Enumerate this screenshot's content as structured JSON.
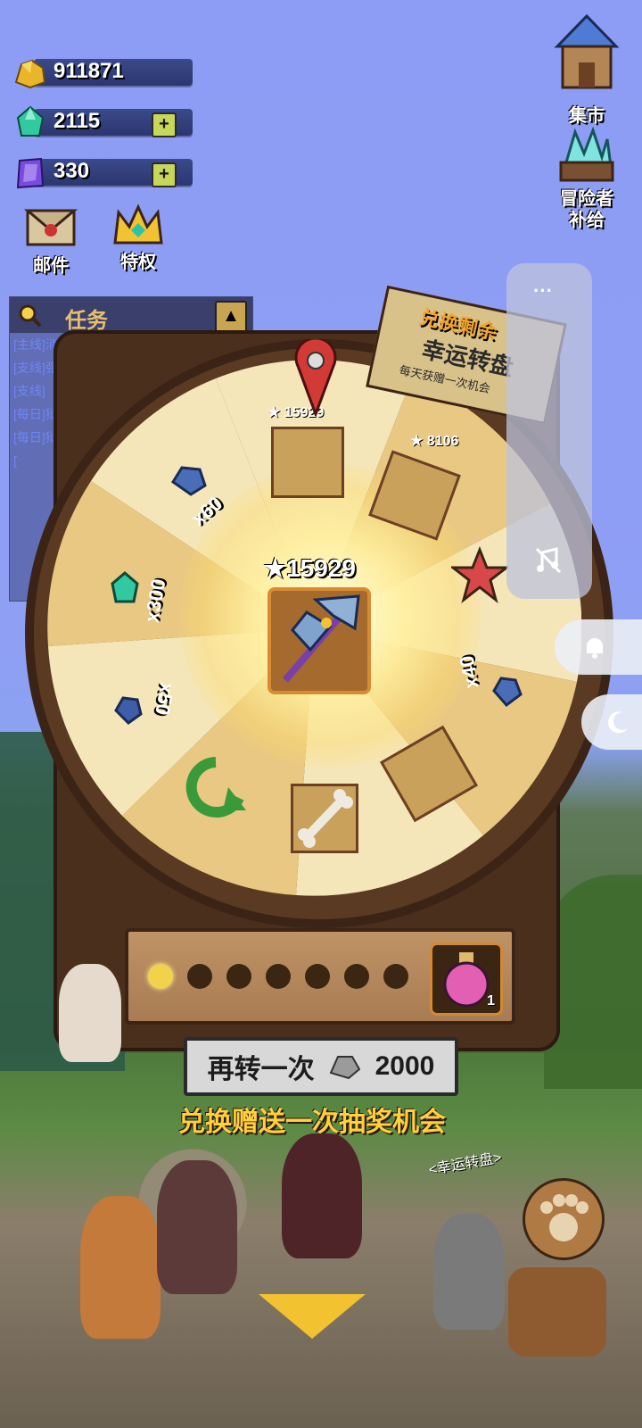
{
  "currencies": {
    "gold": {
      "value": "911871",
      "icon": "gold-ore-icon",
      "color": "#e9b629"
    },
    "gems": {
      "value": "2115",
      "icon": "green-gem-icon",
      "color": "#32c9a0",
      "plus": "+"
    },
    "crystals": {
      "value": "330",
      "icon": "purple-crystal-icon",
      "color": "#7a4be0",
      "plus": "+"
    }
  },
  "quick_buttons": {
    "mail": "邮件",
    "privilege": "特权"
  },
  "quests": {
    "title": "任务",
    "items": [
      "[主线]消灭1个地狱的奇美拉",
      "[支线]强化3件装备至+11",
      "[支线]",
      "[每日]狱洞",
      "[每日]狱",
      "["
    ]
  },
  "right_menu": {
    "market": "集市",
    "supply": "冒险者\n补给"
  },
  "wheel": {
    "banner_top": "兑换剩余",
    "banner_title": "幸运转盘",
    "banner_sub": "每天获赠一次机会",
    "top_score": "15929",
    "score_2": "8106",
    "center_score": "15929",
    "labels": [
      "x60",
      "x300",
      "x50",
      "x40"
    ]
  },
  "progress": {
    "dots_total": 7,
    "dots_on": 1,
    "potion_count": "1"
  },
  "spin": {
    "label": "再转一次",
    "cost": "2000"
  },
  "exchange_text": "兑换赠送一次抽奖机会",
  "lucky_sign": "<幸运转盘>",
  "colors": {
    "accent_gold": "#ffcf3e",
    "sky": "#8d9cf4",
    "wood": "#4b2f1d"
  }
}
